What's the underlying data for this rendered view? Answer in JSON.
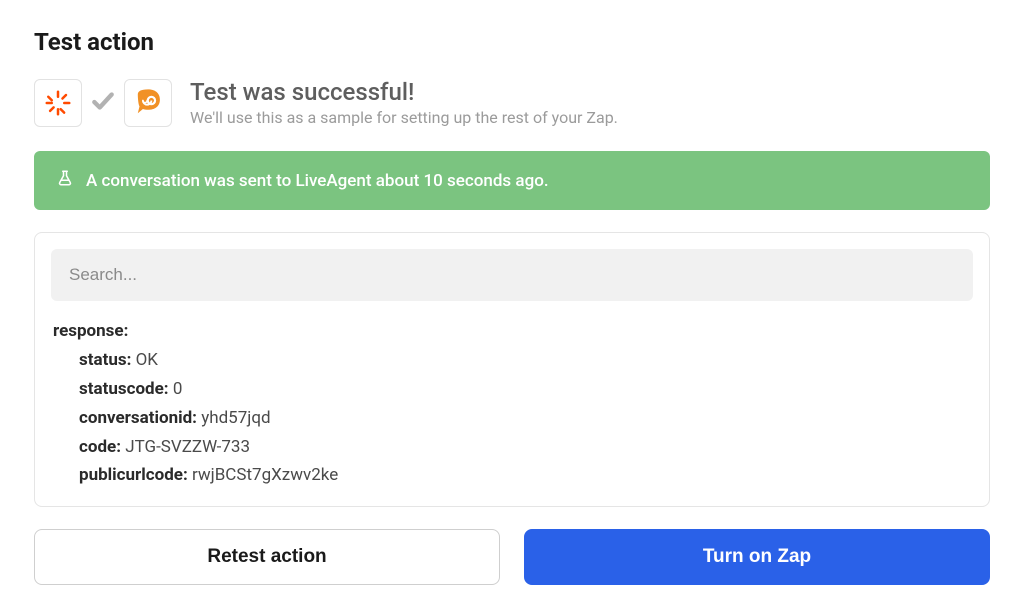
{
  "page": {
    "title": "Test action"
  },
  "success": {
    "title": "Test was successful!",
    "subtitle": "We'll use this as a sample for setting up the rest of your Zap."
  },
  "notice": {
    "text": "A conversation was sent to LiveAgent about 10 seconds ago."
  },
  "search": {
    "placeholder": "Search..."
  },
  "response": {
    "label": "response:",
    "fields": {
      "status": {
        "key": "status:",
        "value": "OK"
      },
      "statuscode": {
        "key": "statuscode:",
        "value": "0"
      },
      "conversationid": {
        "key": "conversationid:",
        "value": "yhd57jqd"
      },
      "code": {
        "key": "code:",
        "value": "JTG-SVZZW-733"
      },
      "publicurlcode": {
        "key": "publicurlcode:",
        "value": "rwjBCSt7gXzwv2ke"
      }
    }
  },
  "buttons": {
    "retest": "Retest action",
    "turn_on": "Turn on Zap"
  }
}
